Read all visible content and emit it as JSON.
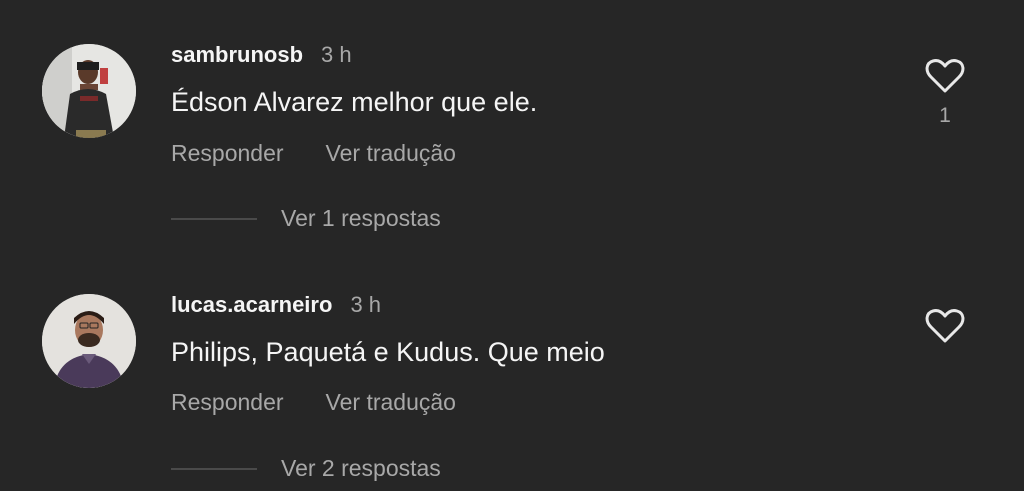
{
  "comments": [
    {
      "username": "sambrunosb",
      "time": "3 h",
      "text": "Édson Alvarez melhor que ele.",
      "reply_label": "Responder",
      "translate_label": "Ver tradução",
      "like_count": "1",
      "view_replies": "Ver 1 respostas",
      "avatar_icon": "user-avatar-photo"
    },
    {
      "username": "lucas.acarneiro",
      "time": "3 h",
      "text": "Philips, Paquetá e Kudus. Que meio",
      "reply_label": "Responder",
      "translate_label": "Ver tradução",
      "view_replies": "Ver 2 respostas",
      "avatar_icon": "user-avatar-photo"
    }
  ],
  "colors": {
    "background": "#262626",
    "primary_text": "#f5f5f5",
    "secondary_text": "#a8a8a8"
  }
}
